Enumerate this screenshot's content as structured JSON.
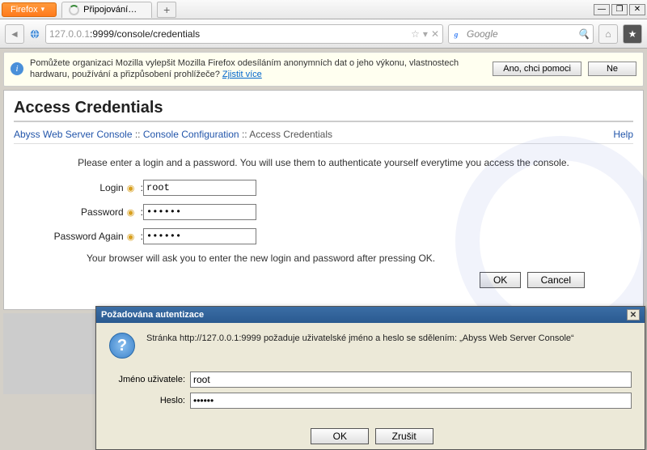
{
  "browser": "Firefox",
  "tab_title": "Připojování…",
  "url_gray": "127.0.0.1",
  "url_rest": ":9999/console/credentials",
  "search_placeholder": "Google",
  "info_text": "Pomůžete organizaci Mozilla vylepšit Mozilla Firefox odesíláním anonymních dat o jeho výkonu, vlastnostech hardwaru, používání a přizpůsobení prohlížeče?  ",
  "info_link": "Zjistit více",
  "info_btn_yes": "Ano, chci pomoci",
  "info_btn_no": "Ne",
  "page_title": "Access Credentials",
  "crumb1": "Abyss Web Server Console",
  "crumb2": "Console Configuration",
  "crumb3": "Access Credentials",
  "help": "Help",
  "sep": " :: ",
  "instruction": "Please enter a login and a password. You will use them to authenticate yourself everytime you access the console.",
  "login_label": "Login",
  "pw_label": "Password",
  "pw2_label": "Password Again",
  "login_val": "root",
  "pw_val": "••••••",
  "pw2_val": "••••••",
  "note": "Your browser will ask you to enter the new login and password after pressing OK.",
  "ok": "OK",
  "cancel": "Cancel",
  "dlg_title": "Požadována autentizace",
  "dlg_msg": "Stránka http://127.0.0.1:9999 požaduje uživatelské jméno a heslo se sdělením: „Abyss Web Server Console“",
  "dlg_user_lbl": "Jméno uživatele:",
  "dlg_pw_lbl": "Heslo:",
  "dlg_user_val": "root",
  "dlg_pw_val": "••••••",
  "dlg_ok": "OK",
  "dlg_cancel": "Zrušit",
  "colon": " :"
}
